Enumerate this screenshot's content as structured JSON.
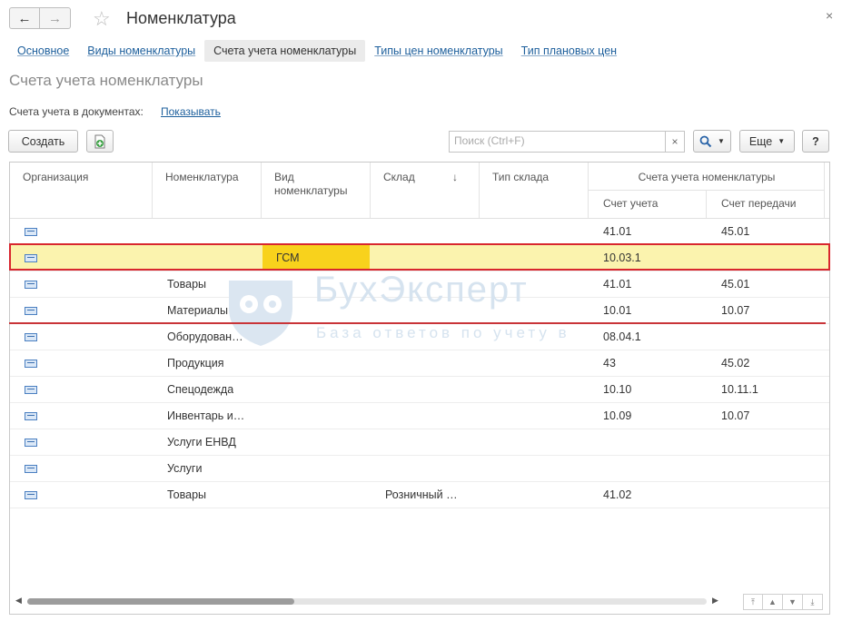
{
  "window": {
    "title": "Номенклатура",
    "close": "×"
  },
  "nav": {
    "back": "←",
    "forward": "→",
    "favorite": "☆"
  },
  "tabs": [
    {
      "label": "Основное",
      "active": false
    },
    {
      "label": "Виды номенклатуры",
      "active": false
    },
    {
      "label": "Счета учета номенклатуры",
      "active": true
    },
    {
      "label": "Типы цен номенклатуры",
      "active": false
    },
    {
      "label": "Тип плановых цен",
      "active": false
    }
  ],
  "section": {
    "title": "Счета учета номенклатуры",
    "accounts_label": "Счета учета в документах:",
    "accounts_link": "Показывать"
  },
  "toolbar": {
    "create_label": "Создать",
    "search_placeholder": "Поиск (Ctrl+F)",
    "search_clear": "×",
    "find_icon": "search-icon",
    "more_label": "Еще",
    "help_label": "?"
  },
  "table": {
    "headers": {
      "org": "Организация",
      "nomenclature": "Номенклатура",
      "kind_line1": "Вид",
      "kind_line2": "номенклатуры",
      "warehouse": "Склад",
      "sort_arrow": "↓",
      "warehouse_type": "Тип склада",
      "accounts_group": "Счета учета номенклатуры",
      "account": "Счет учета",
      "transfer_account": "Счет передачи"
    },
    "rows": [
      {
        "org": "",
        "nomenclature": "",
        "kind": "",
        "warehouse": "",
        "warehouse_type": "",
        "account": "41.01",
        "transfer": "45.01"
      },
      {
        "org": "",
        "nomenclature": "",
        "kind": "ГСМ",
        "warehouse": "",
        "warehouse_type": "",
        "account": "10.03.1",
        "transfer": ""
      },
      {
        "org": "",
        "nomenclature": "Товары",
        "kind": "",
        "warehouse": "",
        "warehouse_type": "",
        "account": "41.01",
        "transfer": "45.01"
      },
      {
        "org": "",
        "nomenclature": "Материалы",
        "kind": "",
        "warehouse": "",
        "warehouse_type": "",
        "account": "10.01",
        "transfer": "10.07"
      },
      {
        "org": "",
        "nomenclature": "Оборудован…",
        "kind": "",
        "warehouse": "",
        "warehouse_type": "",
        "account": "08.04.1",
        "transfer": ""
      },
      {
        "org": "",
        "nomenclature": "Продукция",
        "kind": "",
        "warehouse": "",
        "warehouse_type": "",
        "account": "43",
        "transfer": "45.02"
      },
      {
        "org": "",
        "nomenclature": "Спецодежда",
        "kind": "",
        "warehouse": "",
        "warehouse_type": "",
        "account": "10.10",
        "transfer": "10.11.1"
      },
      {
        "org": "",
        "nomenclature": "Инвентарь и…",
        "kind": "",
        "warehouse": "",
        "warehouse_type": "",
        "account": "10.09",
        "transfer": "10.07"
      },
      {
        "org": "",
        "nomenclature": "Услуги ЕНВД",
        "kind": "",
        "warehouse": "",
        "warehouse_type": "",
        "account": "",
        "transfer": ""
      },
      {
        "org": "",
        "nomenclature": "Услуги",
        "kind": "",
        "warehouse": "",
        "warehouse_type": "",
        "account": "",
        "transfer": ""
      },
      {
        "org": "",
        "nomenclature": "Товары",
        "kind": "",
        "warehouse": "Розничный …",
        "warehouse_type": "",
        "account": "41.02",
        "transfer": ""
      }
    ]
  },
  "watermark": {
    "brand": "БухЭксперт",
    "tagline": "База ответов по учету в"
  },
  "colors": {
    "selection_row": "#fbf3ae",
    "selection_cell": "#f8d21c",
    "highlight_red": "#d8262e",
    "link": "#1d5f9c"
  }
}
